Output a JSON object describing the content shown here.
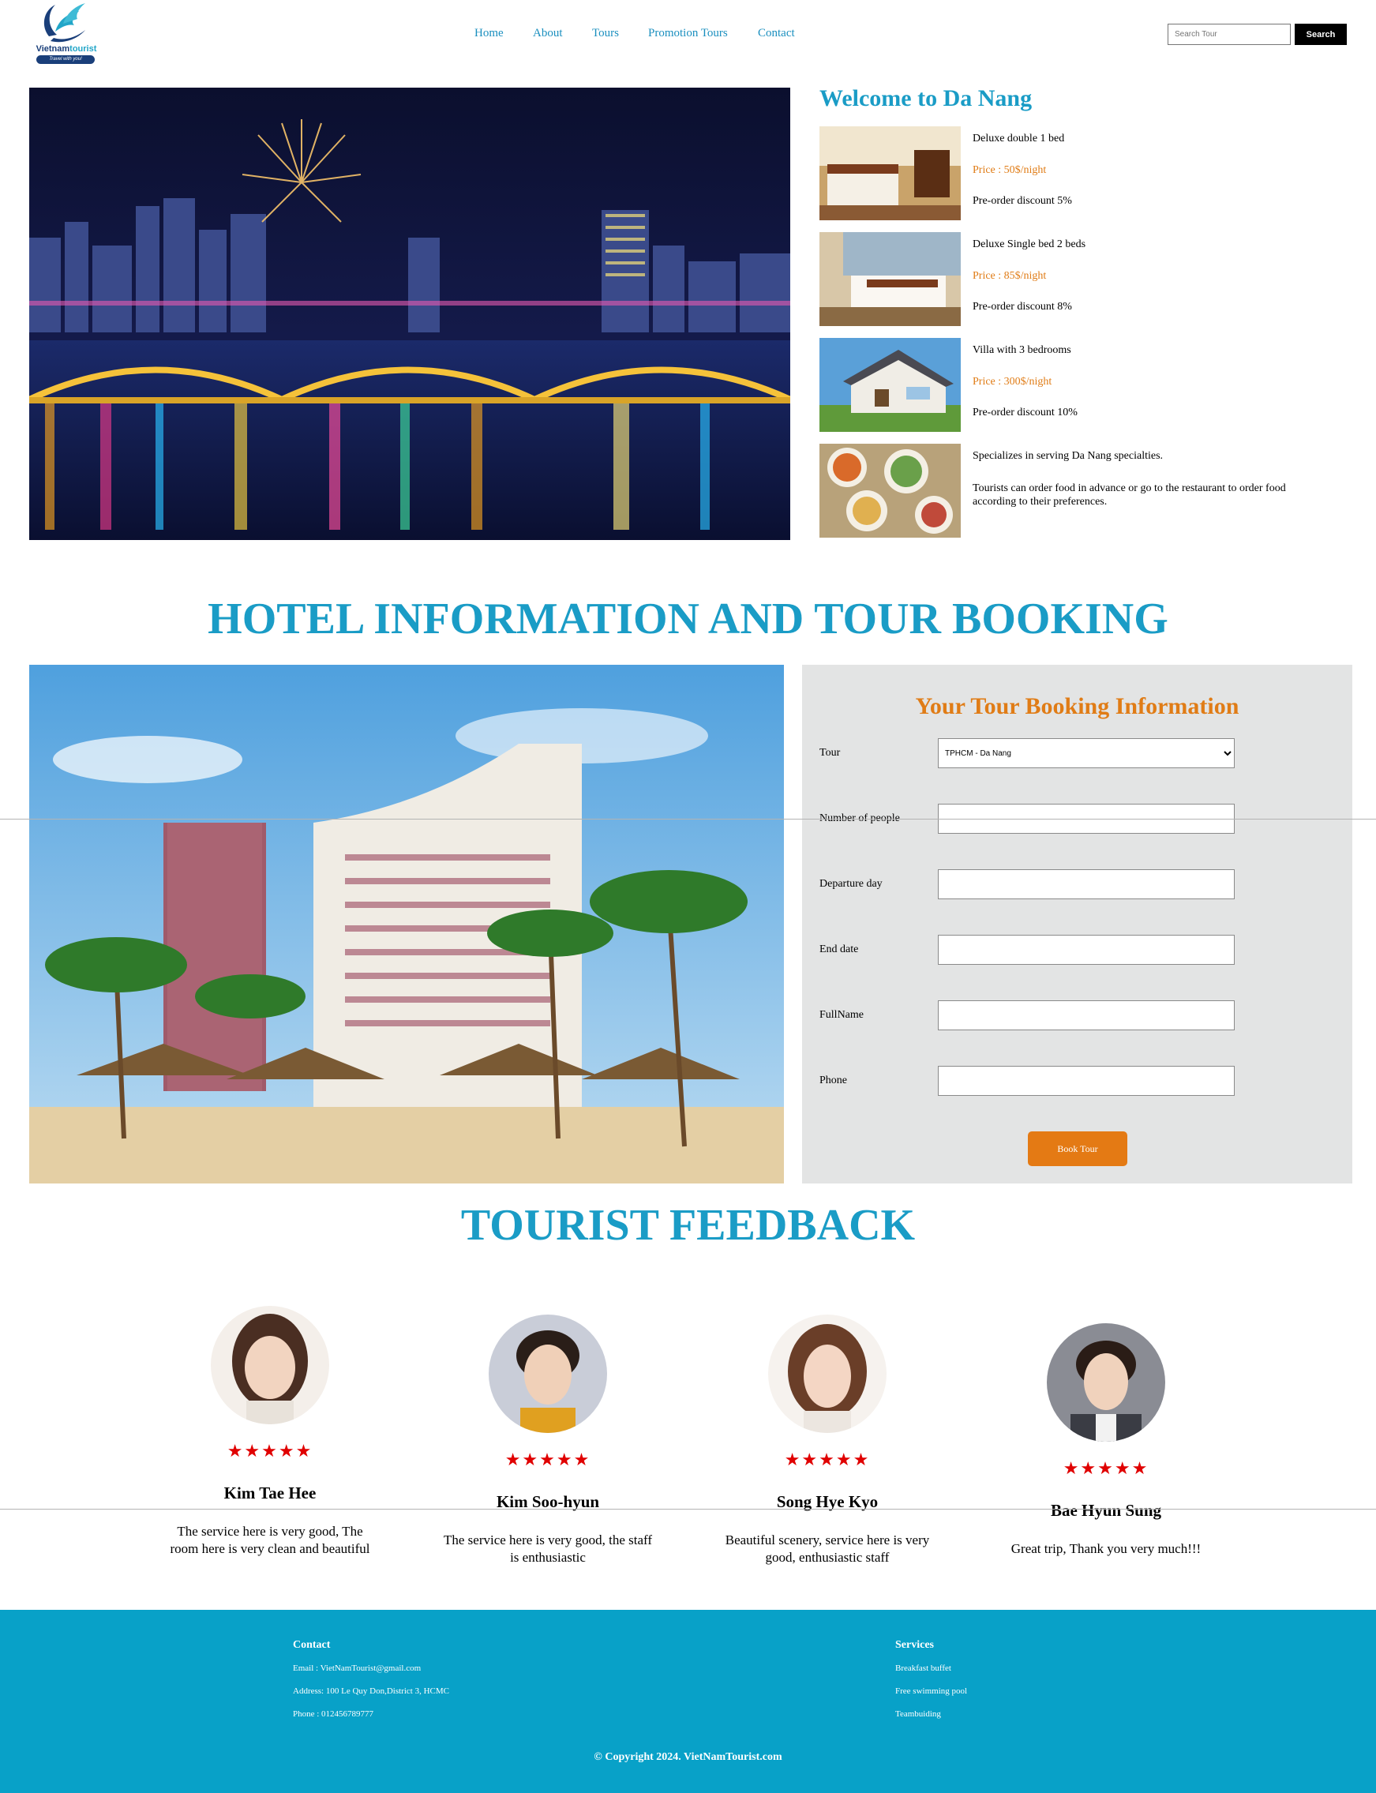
{
  "header": {
    "logo": {
      "brand_main": "Vietnam",
      "brand_accent": "tourist",
      "tagline": "Travel with you!"
    },
    "nav": [
      {
        "label": "Home"
      },
      {
        "label": "About"
      },
      {
        "label": "Tours"
      },
      {
        "label": "Promotion Tours"
      },
      {
        "label": "Contact"
      }
    ],
    "search": {
      "placeholder": "Search Tour",
      "button_label": "Search"
    }
  },
  "welcome": {
    "title": "Welcome to Da Nang",
    "rooms": [
      {
        "name": "Deluxe double 1 bed",
        "price": "Price : 50$/night",
        "discount": "Pre-order discount 5%"
      },
      {
        "name": "Deluxe Single bed 2 beds",
        "price": "Price : 85$/night",
        "discount": "Pre-order discount 8%"
      },
      {
        "name": "Villa with 3 bedrooms",
        "price": "Price : 300$/night",
        "discount": "Pre-order discount 10%"
      }
    ],
    "specialty": {
      "line1": "Specializes in serving Da Nang specialties.",
      "line2": "Tourists can order food in advance or go to the restaurant to order food according to their preferences."
    }
  },
  "hotel_section": {
    "title": "HOTEL INFORMATION AND TOUR BOOKING",
    "form": {
      "title": "Your Tour Booking Information",
      "tour_label": "Tour",
      "tour_selected": "TPHCM - Da Nang",
      "people_label": "Number of people",
      "departure_label": "Departure day",
      "end_label": "End date",
      "fullname_label": "FullName",
      "phone_label": "Phone",
      "submit_label": "Book Tour"
    }
  },
  "feedback": {
    "title": "TOURIST FEEDBACK",
    "items": [
      {
        "name": "Kim Tae Hee",
        "stars": "★★★★★",
        "quote": "The service here is very good, The room here is very clean and beautiful"
      },
      {
        "name": "Kim Soo-hyun",
        "stars": "★★★★★",
        "quote": "The service here is very good, the staff is enthusiastic"
      },
      {
        "name": "Song Hye Kyo",
        "stars": "★★★★★",
        "quote": "Beautiful scenery, service here is very good, enthusiastic staff"
      },
      {
        "name": "Bae Hyun Sung",
        "stars": "★★★★★",
        "quote": "Great trip, Thank you very much!!!"
      }
    ]
  },
  "footer": {
    "contact": {
      "title": "Contact",
      "email": "Email : VietNamTourist@gmail.com",
      "address": "Address: 100 Le Quy Don,District 3, HCMC",
      "phone": "Phone : 012456789777"
    },
    "services": {
      "title": "Services",
      "items": [
        "Breakfast buffet",
        "Free swimming pool",
        "Teambuiding"
      ]
    },
    "copyright": "© Copyright 2024. VietNamTourist.com"
  },
  "colors": {
    "primary": "#1a9cc6",
    "accent": "#e07c16",
    "footer_bg": "#08a1c8",
    "star": "#e00000"
  },
  "icons": {
    "logo": "bird-logo-icon",
    "rating": "star-icon"
  }
}
